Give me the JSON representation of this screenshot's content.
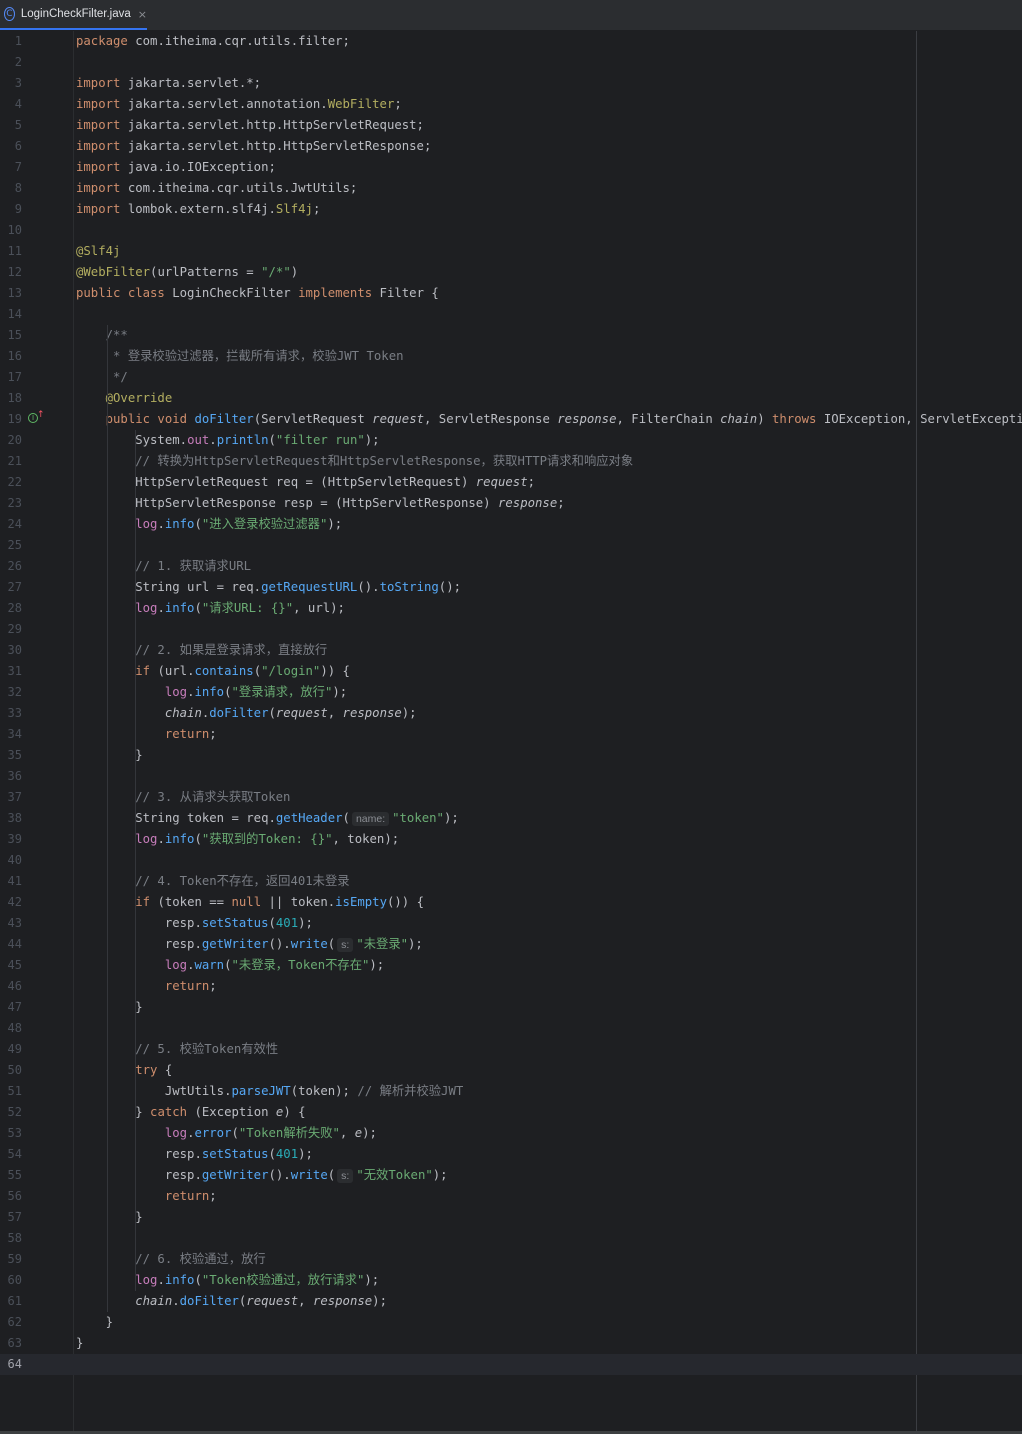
{
  "tab": {
    "icon": "C",
    "label": "LoginCheckFilter.java",
    "close": "×"
  },
  "editor": {
    "current_line": 64,
    "lines": [
      [
        [
          "kw",
          "package"
        ],
        [
          "",
          " com.itheima.cqr.utils.filter;"
        ]
      ],
      [],
      [
        [
          "kw",
          "import"
        ],
        [
          "",
          " jakarta.servlet.*;"
        ]
      ],
      [
        [
          "kw",
          "import"
        ],
        [
          "",
          " jakarta.servlet.annotation."
        ],
        [
          "ann",
          "WebFilter"
        ],
        [
          "",
          ";"
        ]
      ],
      [
        [
          "kw",
          "import"
        ],
        [
          "",
          " jakarta.servlet.http.HttpServletRequest;"
        ]
      ],
      [
        [
          "kw",
          "import"
        ],
        [
          "",
          " jakarta.servlet.http.HttpServletResponse;"
        ]
      ],
      [
        [
          "kw",
          "import"
        ],
        [
          "",
          " java.io.IOException;"
        ]
      ],
      [
        [
          "kw",
          "import"
        ],
        [
          "",
          " com.itheima.cqr.utils.JwtUtils;"
        ]
      ],
      [
        [
          "kw",
          "import"
        ],
        [
          "",
          " lombok.extern.slf4j."
        ],
        [
          "ann",
          "Slf4j"
        ],
        [
          "",
          ";"
        ]
      ],
      [],
      [
        [
          "ann",
          "@Slf4j"
        ]
      ],
      [
        [
          "ann",
          "@WebFilter"
        ],
        [
          "",
          "(urlPatterns = "
        ],
        [
          "str",
          "\"/*\""
        ],
        [
          "",
          ")"
        ]
      ],
      [
        [
          "kw",
          "public class"
        ],
        [
          "",
          " LoginCheckFilter "
        ],
        [
          "kw",
          "implements"
        ],
        [
          "",
          " Filter {"
        ]
      ],
      [],
      [
        [
          "cm",
          "    /**"
        ]
      ],
      [
        [
          "cm",
          "     * 登录校验过滤器，拦截所有请求，校验JWT Token"
        ]
      ],
      [
        [
          "cm",
          "     */"
        ]
      ],
      [
        [
          "ann",
          "    @Override"
        ]
      ],
      [
        [
          "kw",
          "    public void"
        ],
        [
          "",
          " "
        ],
        [
          "fn",
          "doFilter"
        ],
        [
          "",
          "(ServletRequest "
        ],
        [
          "par",
          "request"
        ],
        [
          "",
          ", ServletResponse "
        ],
        [
          "par",
          "response"
        ],
        [
          "",
          ", FilterChain "
        ],
        [
          "par",
          "chain"
        ],
        [
          "",
          ") "
        ],
        [
          "kw",
          "throws"
        ],
        [
          "",
          " IOException, ServletException {"
        ]
      ],
      [
        [
          "",
          "        System."
        ],
        [
          "fld",
          "out"
        ],
        [
          "",
          "."
        ],
        [
          "fn",
          "println"
        ],
        [
          "",
          "("
        ],
        [
          "str",
          "\"filter run\""
        ],
        [
          "",
          ");"
        ]
      ],
      [
        [
          "cm",
          "        // 转换为HttpServletRequest和HttpServletResponse，获取HTTP请求和响应对象"
        ]
      ],
      [
        [
          "",
          "        HttpServletRequest req = (HttpServletRequest) "
        ],
        [
          "par",
          "request"
        ],
        [
          "",
          ";"
        ]
      ],
      [
        [
          "",
          "        HttpServletResponse resp = (HttpServletResponse) "
        ],
        [
          "par",
          "response"
        ],
        [
          "",
          ";"
        ]
      ],
      [
        [
          "fld",
          "        log"
        ],
        [
          "",
          "."
        ],
        [
          "fn",
          "info"
        ],
        [
          "",
          "("
        ],
        [
          "str",
          "\"进入登录校验过滤器\""
        ],
        [
          "",
          ");"
        ]
      ],
      [],
      [
        [
          "cm",
          "        // 1. 获取请求URL"
        ]
      ],
      [
        [
          "",
          "        String url = req."
        ],
        [
          "fn",
          "getRequestURL"
        ],
        [
          "",
          "()."
        ],
        [
          "fn",
          "toString"
        ],
        [
          "",
          "();"
        ]
      ],
      [
        [
          "fld",
          "        log"
        ],
        [
          "",
          "."
        ],
        [
          "fn",
          "info"
        ],
        [
          "",
          "("
        ],
        [
          "str",
          "\"请求URL: {}\""
        ],
        [
          "",
          ", url);"
        ]
      ],
      [],
      [
        [
          "cm",
          "        // 2. 如果是登录请求，直接放行"
        ]
      ],
      [
        [
          "kw",
          "        if"
        ],
        [
          "",
          " (url."
        ],
        [
          "fn",
          "contains"
        ],
        [
          "",
          "("
        ],
        [
          "str",
          "\"/login\""
        ],
        [
          "",
          ")) {"
        ]
      ],
      [
        [
          "fld",
          "            log"
        ],
        [
          "",
          "."
        ],
        [
          "fn",
          "info"
        ],
        [
          "",
          "("
        ],
        [
          "str",
          "\"登录请求，放行\""
        ],
        [
          "",
          ");"
        ]
      ],
      [
        [
          "par",
          "            chain"
        ],
        [
          "",
          "."
        ],
        [
          "fn",
          "doFilter"
        ],
        [
          "",
          "("
        ],
        [
          "par",
          "request"
        ],
        [
          "",
          ", "
        ],
        [
          "par",
          "response"
        ],
        [
          "",
          ");"
        ]
      ],
      [
        [
          "kw",
          "            return"
        ],
        [
          "",
          ";"
        ]
      ],
      [
        [
          "",
          "        }"
        ]
      ],
      [],
      [
        [
          "cm",
          "        // 3. 从请求头获取Token"
        ]
      ],
      [
        [
          "",
          "        String token = req."
        ],
        [
          "fn",
          "getHeader"
        ],
        [
          "",
          "("
        ],
        [
          "hint",
          "name:"
        ],
        [
          "str",
          "\"token\""
        ],
        [
          "",
          ");"
        ]
      ],
      [
        [
          "fld",
          "        log"
        ],
        [
          "",
          "."
        ],
        [
          "fn",
          "info"
        ],
        [
          "",
          "("
        ],
        [
          "str",
          "\"获取到的Token: {}\""
        ],
        [
          "",
          ", token);"
        ]
      ],
      [],
      [
        [
          "cm",
          "        // 4. Token不存在，返回401未登录"
        ]
      ],
      [
        [
          "kw",
          "        if"
        ],
        [
          "",
          " (token == "
        ],
        [
          "kw",
          "null"
        ],
        [
          "",
          " || token."
        ],
        [
          "fn",
          "isEmpty"
        ],
        [
          "",
          "()) {"
        ]
      ],
      [
        [
          "",
          "            resp."
        ],
        [
          "fn",
          "setStatus"
        ],
        [
          "",
          "("
        ],
        [
          "num",
          "401"
        ],
        [
          "",
          ");"
        ]
      ],
      [
        [
          "",
          "            resp."
        ],
        [
          "fn",
          "getWriter"
        ],
        [
          "",
          "()."
        ],
        [
          "fn",
          "write"
        ],
        [
          "",
          "("
        ],
        [
          "hint",
          "s:"
        ],
        [
          "str",
          "\"未登录\""
        ],
        [
          "",
          ");"
        ]
      ],
      [
        [
          "fld",
          "            log"
        ],
        [
          "",
          "."
        ],
        [
          "fn",
          "warn"
        ],
        [
          "",
          "("
        ],
        [
          "str",
          "\"未登录，Token不存在\""
        ],
        [
          "",
          ");"
        ]
      ],
      [
        [
          "kw",
          "            return"
        ],
        [
          "",
          ";"
        ]
      ],
      [
        [
          "",
          "        }"
        ]
      ],
      [],
      [
        [
          "cm",
          "        // 5. 校验Token有效性"
        ]
      ],
      [
        [
          "kw",
          "        try"
        ],
        [
          "",
          " {"
        ]
      ],
      [
        [
          "",
          "            JwtUtils."
        ],
        [
          "fn",
          "parseJWT"
        ],
        [
          "",
          "(token); "
        ],
        [
          "cm",
          "// 解析并校验JWT"
        ]
      ],
      [
        [
          "",
          "        } "
        ],
        [
          "kw",
          "catch"
        ],
        [
          "",
          " (Exception "
        ],
        [
          "par",
          "e"
        ],
        [
          "",
          ") {"
        ]
      ],
      [
        [
          "fld",
          "            log"
        ],
        [
          "",
          "."
        ],
        [
          "fn",
          "error"
        ],
        [
          "",
          "("
        ],
        [
          "str",
          "\"Token解析失败\""
        ],
        [
          "",
          ", "
        ],
        [
          "par",
          "e"
        ],
        [
          "",
          ");"
        ]
      ],
      [
        [
          "",
          "            resp."
        ],
        [
          "fn",
          "setStatus"
        ],
        [
          "",
          "("
        ],
        [
          "num",
          "401"
        ],
        [
          "",
          ");"
        ]
      ],
      [
        [
          "",
          "            resp."
        ],
        [
          "fn",
          "getWriter"
        ],
        [
          "",
          "()."
        ],
        [
          "fn",
          "write"
        ],
        [
          "",
          "("
        ],
        [
          "hint",
          "s:"
        ],
        [
          "str",
          "\"无效Token\""
        ],
        [
          "",
          ");"
        ]
      ],
      [
        [
          "kw",
          "            return"
        ],
        [
          "",
          ";"
        ]
      ],
      [
        [
          "",
          "        }"
        ]
      ],
      [],
      [
        [
          "cm",
          "        // 6. 校验通过，放行"
        ]
      ],
      [
        [
          "fld",
          "        log"
        ],
        [
          "",
          "."
        ],
        [
          "fn",
          "info"
        ],
        [
          "",
          "("
        ],
        [
          "str",
          "\"Token校验通过，放行请求\""
        ],
        [
          "",
          ");"
        ]
      ],
      [
        [
          "par",
          "        chain"
        ],
        [
          "",
          "."
        ],
        [
          "fn",
          "doFilter"
        ],
        [
          "",
          "("
        ],
        [
          "par",
          "request"
        ],
        [
          "",
          ", "
        ],
        [
          "par",
          "response"
        ],
        [
          "",
          ");"
        ]
      ],
      [
        [
          "",
          "    }"
        ]
      ],
      [
        [
          "",
          "}"
        ]
      ],
      []
    ]
  }
}
